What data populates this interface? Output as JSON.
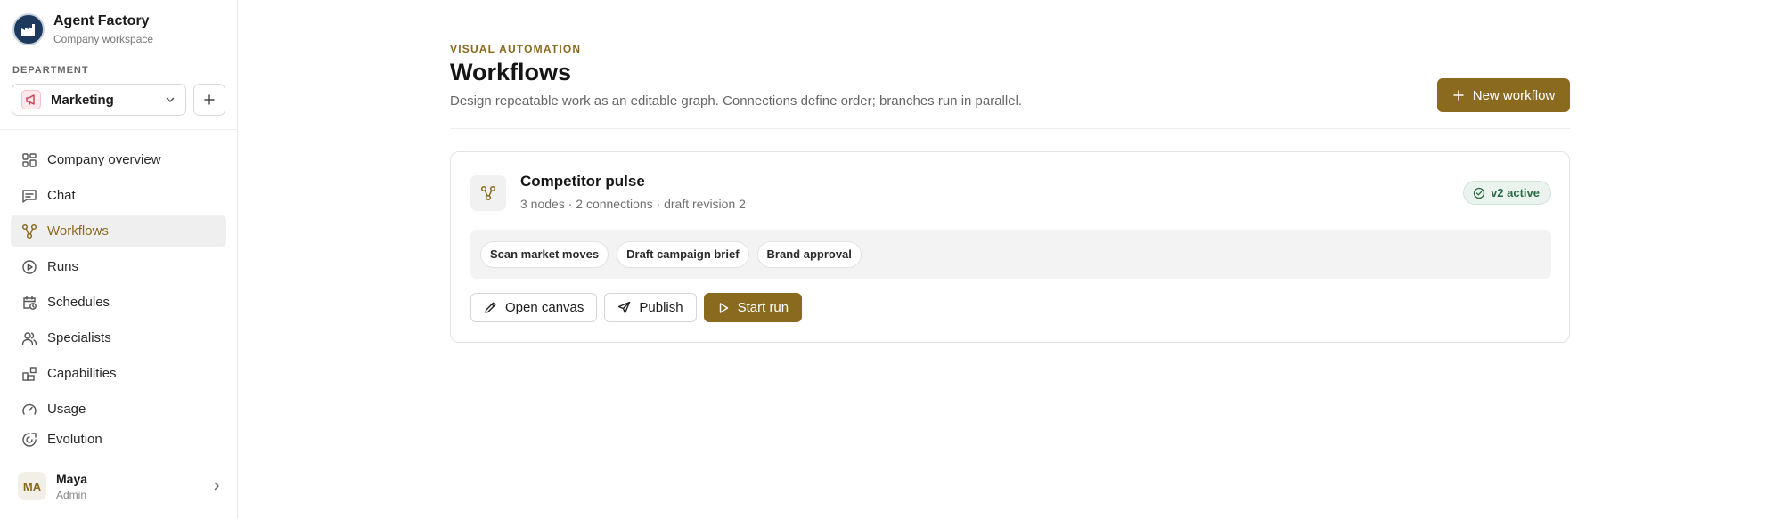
{
  "sidebar": {
    "brand_name": "Agent Factory",
    "brand_sub": "Company workspace",
    "department_label": "DEPARTMENT",
    "department_value": "Marketing",
    "nav": [
      {
        "label": "Company overview",
        "icon": "grid-icon"
      },
      {
        "label": "Chat",
        "icon": "chat-icon"
      },
      {
        "label": "Workflows",
        "icon": "workflow-icon",
        "active": true
      },
      {
        "label": "Runs",
        "icon": "play-circle-icon"
      },
      {
        "label": "Schedules",
        "icon": "calendar-clock-icon"
      },
      {
        "label": "Specialists",
        "icon": "users-icon"
      },
      {
        "label": "Capabilities",
        "icon": "blocks-icon"
      },
      {
        "label": "Usage",
        "icon": "gauge-icon"
      },
      {
        "label": "Evolution",
        "icon": "evolution-icon"
      }
    ],
    "user": {
      "initials": "MA",
      "name": "Maya",
      "role": "Admin"
    }
  },
  "header": {
    "eyebrow": "VISUAL AUTOMATION",
    "title": "Workflows",
    "subtitle": "Design repeatable work as an editable graph. Connections define order; branches run in parallel.",
    "new_button": "New workflow"
  },
  "workflow": {
    "title": "Competitor pulse",
    "meta": "3 nodes · 2 connections · draft revision 2",
    "badge": "v2 active",
    "steps": [
      "Scan market moves",
      "Draft campaign brief",
      "Brand approval"
    ],
    "actions": {
      "open": "Open canvas",
      "publish": "Publish",
      "start": "Start run"
    }
  },
  "colors": {
    "accent": "#8a6a1f",
    "badge_green": "#2e6b45",
    "active_nav_bg": "#efefef"
  }
}
